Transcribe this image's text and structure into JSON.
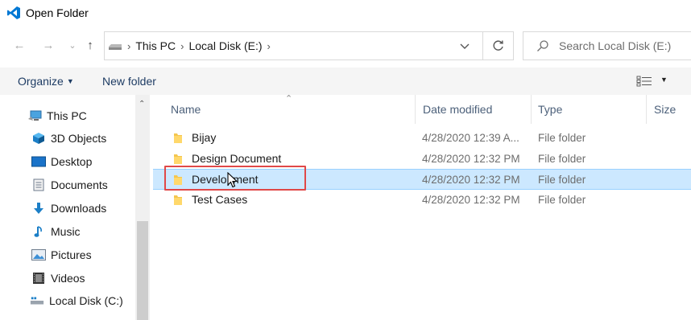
{
  "window": {
    "title": "Open Folder",
    "app_icon": "vscode-icon"
  },
  "nav": {
    "back_icon": "arrow-left-icon",
    "forward_icon": "arrow-right-icon",
    "recent_icon": "chevron-down-icon",
    "up_icon": "arrow-up-icon"
  },
  "address": {
    "drive_icon": "drive-icon",
    "crumbs": [
      "This PC",
      "Local Disk (E:)"
    ],
    "dropdown_icon": "chevron-down-icon",
    "refresh_icon": "refresh-icon"
  },
  "search": {
    "placeholder": "Search Local Disk (E:)",
    "icon": "search-icon"
  },
  "toolbar": {
    "organize_label": "Organize",
    "new_folder_label": "New folder",
    "view_icon": "details-view-icon"
  },
  "sidebar": {
    "items": [
      {
        "label": "This PC",
        "icon": "computer-icon"
      },
      {
        "label": "3D Objects",
        "icon": "cube-icon"
      },
      {
        "label": "Desktop",
        "icon": "desktop-icon"
      },
      {
        "label": "Documents",
        "icon": "document-icon"
      },
      {
        "label": "Downloads",
        "icon": "download-icon"
      },
      {
        "label": "Music",
        "icon": "music-icon"
      },
      {
        "label": "Pictures",
        "icon": "picture-icon"
      },
      {
        "label": "Videos",
        "icon": "video-icon"
      },
      {
        "label": "Local Disk (C:)",
        "icon": "drive-icon"
      }
    ]
  },
  "file_list": {
    "columns": [
      "Name",
      "Date modified",
      "Type",
      "Size"
    ],
    "rows": [
      {
        "name": "Bijay",
        "date": "4/28/2020 12:39 A...",
        "type": "File folder",
        "selected": false
      },
      {
        "name": "Design Document",
        "date": "4/28/2020 12:32 PM",
        "type": "File folder",
        "selected": false
      },
      {
        "name": "Development",
        "date": "4/28/2020 12:32 PM",
        "type": "File folder",
        "selected": true
      },
      {
        "name": "Test Cases",
        "date": "4/28/2020 12:32 PM",
        "type": "File folder",
        "selected": false
      }
    ]
  },
  "colors": {
    "selection_bg": "#cce8ff",
    "highlight_border": "#e04848",
    "folder_yellow": "#f4c64e",
    "toolbar_text": "#1e3c64"
  }
}
